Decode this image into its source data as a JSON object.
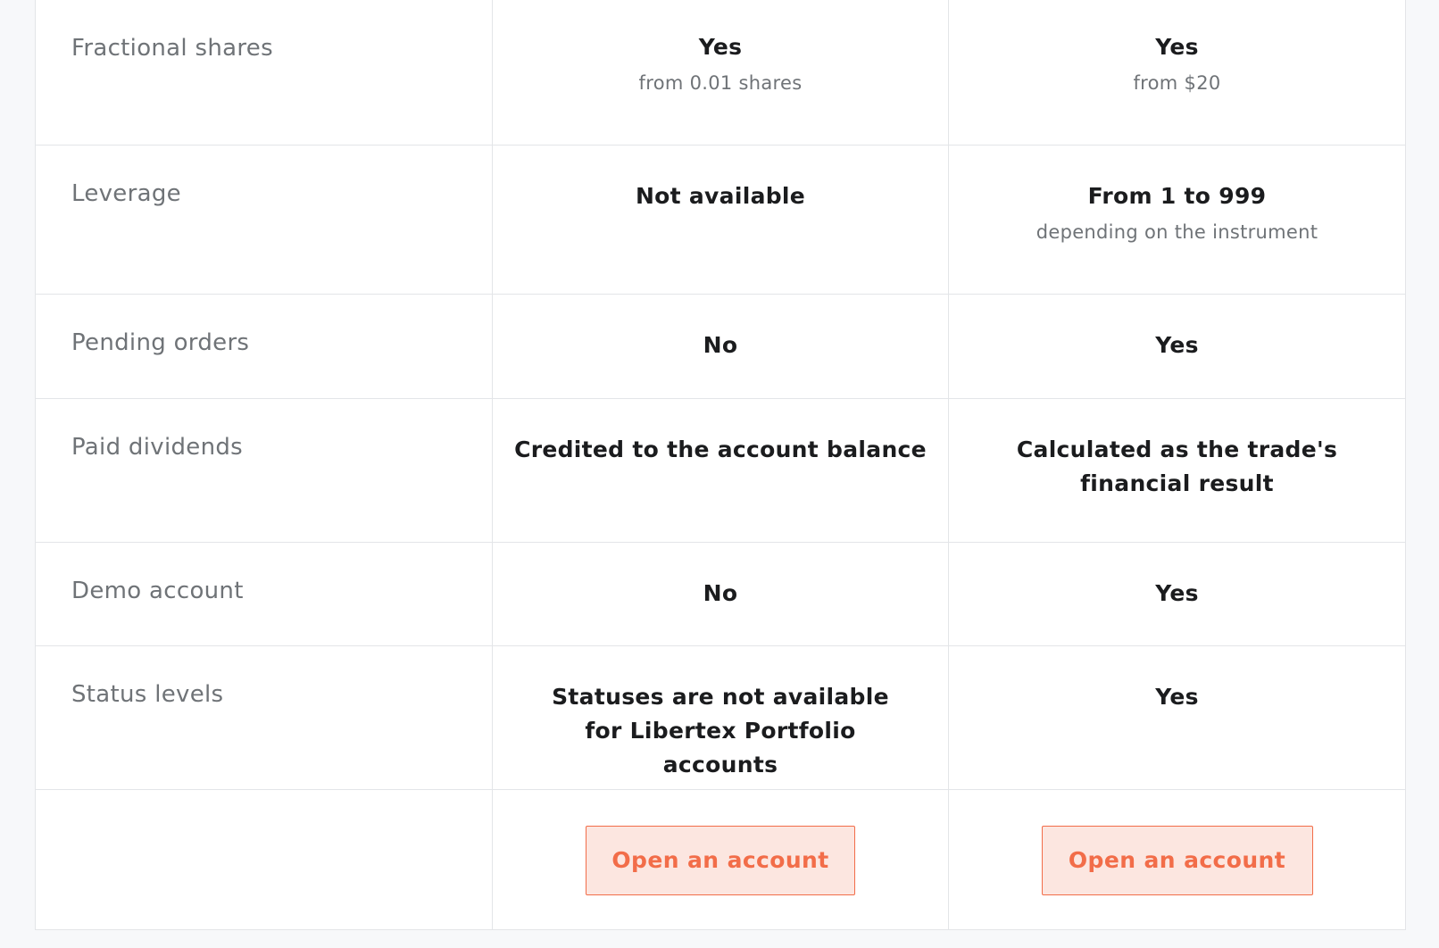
{
  "rows": [
    {
      "label": "Fractional shares",
      "col1": {
        "main": "Yes",
        "sub": "from 0.01 shares"
      },
      "col2": {
        "main": "Yes",
        "sub": "from $20"
      }
    },
    {
      "label": "Leverage",
      "col1": {
        "main": "Not available",
        "sub": ""
      },
      "col2": {
        "main": "From 1 to 999",
        "sub": "depending on the instrument"
      }
    },
    {
      "label": "Pending orders",
      "col1": {
        "main": "No"
      },
      "col2": {
        "main": "Yes"
      }
    },
    {
      "label": "Paid dividends",
      "col1": {
        "main": "Credited to the account balance"
      },
      "col2": {
        "main": "Calculated as the trade's financial result"
      }
    },
    {
      "label": "Demo account",
      "col1": {
        "main": "No"
      },
      "col2": {
        "main": "Yes"
      }
    },
    {
      "label": "Status levels",
      "col1": {
        "main": "Statuses are not available for Libertex Portfolio accounts"
      },
      "col2": {
        "main": "Yes"
      }
    }
  ],
  "actions": {
    "col1_button": "Open an account",
    "col2_button": "Open an account"
  },
  "colors": {
    "accent": "#f26d49",
    "button_bg": "#fce6e0",
    "border": "#e3e5e8",
    "label_text": "#6f7377",
    "value_text": "#1b1c1e"
  }
}
